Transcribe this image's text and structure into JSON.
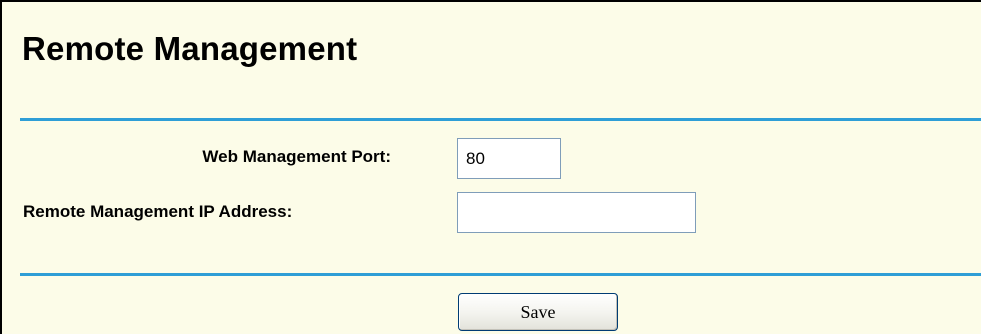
{
  "page": {
    "title": "Remote Management"
  },
  "form": {
    "web_port": {
      "label": "Web Management Port:",
      "value": "80"
    },
    "remote_ip": {
      "label": "Remote Management IP Address:",
      "value": ""
    },
    "save_label": "Save"
  },
  "colors": {
    "background": "#fcfce8",
    "divider": "#2e9ed6"
  }
}
